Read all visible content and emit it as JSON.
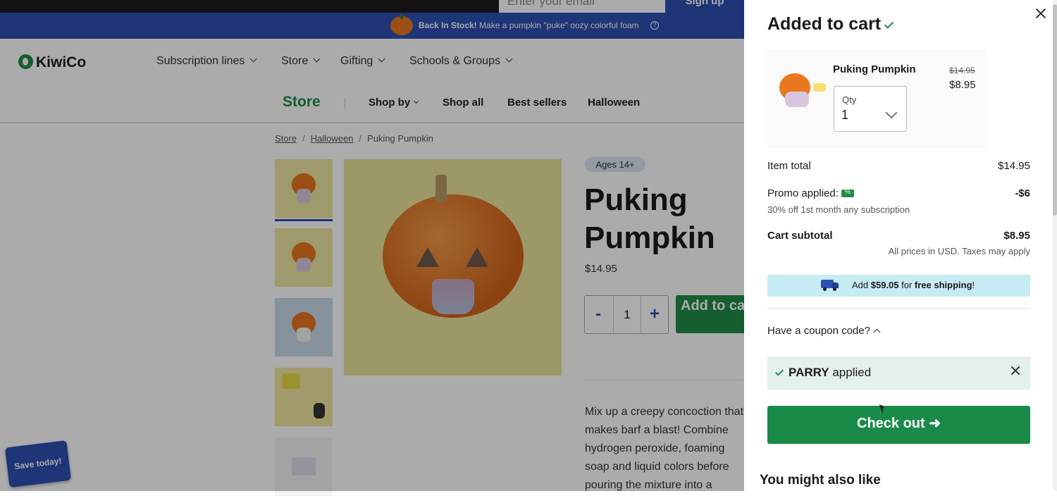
{
  "header": {
    "email_placeholder": "Enter your email",
    "signup_label": "Sign up",
    "promo_bold": "Back In Stock!",
    "promo_text": " Make a pumpkin \"puke\" oozy colorful foam"
  },
  "nav": {
    "logo": "KiwiCo",
    "items": [
      {
        "label": "Subscription lines"
      },
      {
        "label": "Store"
      },
      {
        "label": "Gifting"
      },
      {
        "label": "Schools & Groups"
      }
    ]
  },
  "subnav": {
    "title": "Store",
    "items": [
      {
        "label": "Shop by"
      },
      {
        "label": "Shop all"
      },
      {
        "label": "Best sellers"
      },
      {
        "label": "Halloween"
      }
    ]
  },
  "breadcrumb": {
    "items": [
      "Store",
      "Halloween",
      "Puking Pumpkin"
    ],
    "separator": "/"
  },
  "product": {
    "age_badge": "Ages 14+",
    "title": "Puking Pumpkin",
    "price": "$14.95",
    "quantity": "1",
    "minus_label": "-",
    "plus_label": "+",
    "add_to_cart_label": "Add to cart",
    "description": "Mix up a creepy concoction that makes barf a blast! Combine hydrogen peroxide, foaming soap and liquid colors before pouring the mixture into a carved pumpkin"
  },
  "save_badge": "Save today!",
  "cart": {
    "title": "Added to cart",
    "item_name": "Puking Pumpkin",
    "old_price": "$14.95",
    "new_price": "$8.95",
    "qty_label": "Qty",
    "qty_value": "1",
    "item_total_label": "Item total",
    "item_total_value": "$14.95",
    "promo_label": "Promo applied:",
    "promo_value": "-$6",
    "promo_desc": "30% off 1st month any subscription",
    "subtotal_label": "Cart subtotal",
    "subtotal_value": "$8.95",
    "tax_note": "All prices in USD. Taxes may apply",
    "ship_prefix": "Add ",
    "ship_amount": "$59.05",
    "ship_mid": " for ",
    "ship_bold": "free shipping",
    "ship_suffix": "!",
    "coupon_toggle": "Have a coupon code?",
    "coupon_code": "PARRY",
    "coupon_status": " applied",
    "checkout_label": "Check out ➜",
    "also_like": "You might also like"
  },
  "colors": {
    "brand_green": "#1f8d47",
    "brand_blue": "#2d4fb3",
    "promo_tint": "#e4f1ea",
    "shipping_tint": "#c6ebf2"
  }
}
